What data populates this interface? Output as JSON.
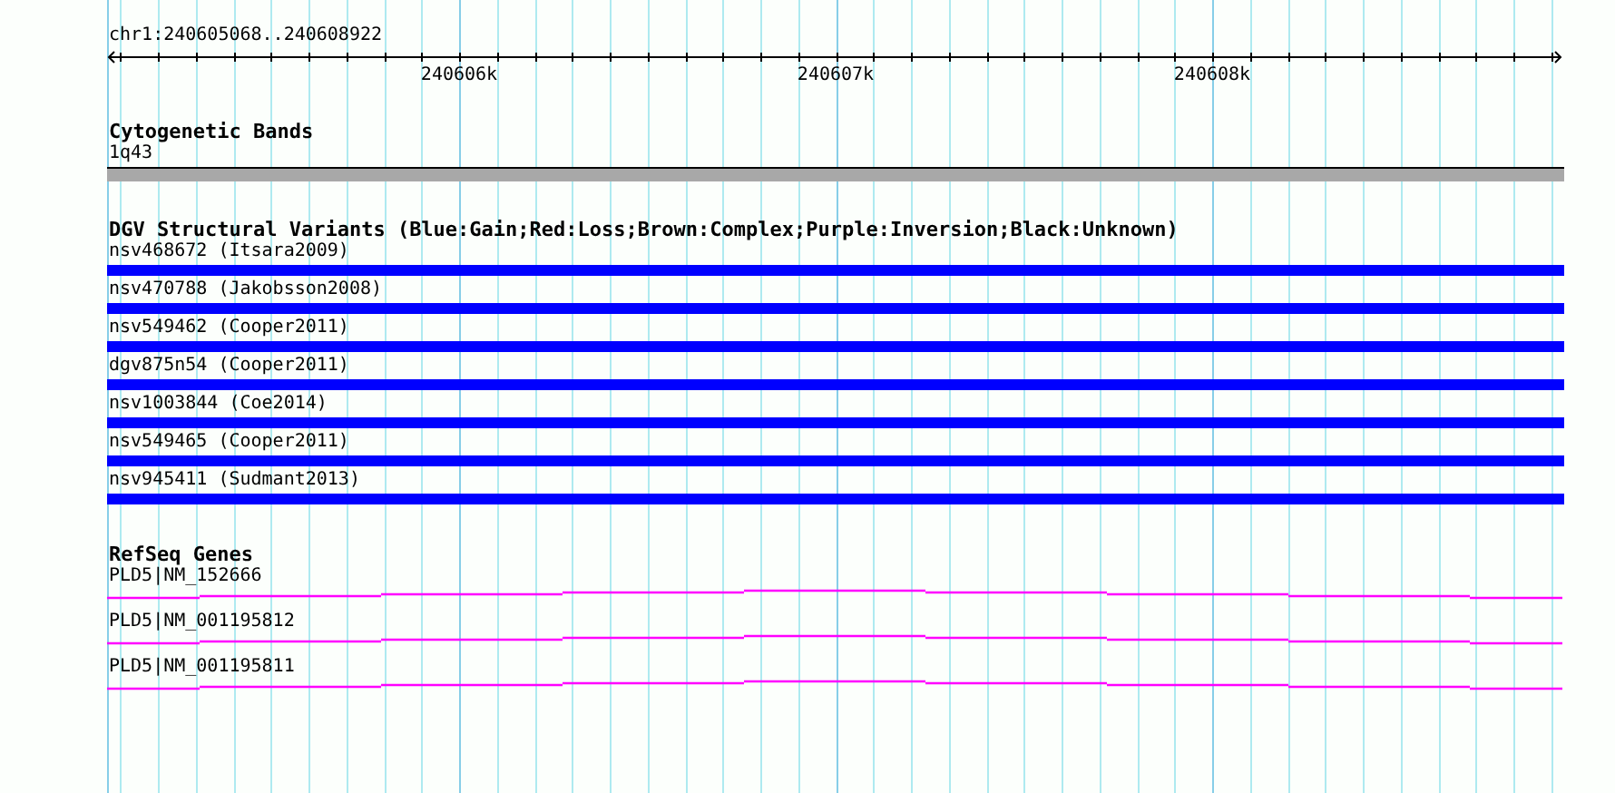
{
  "ruler": {
    "position": "chr1:240605068..240608922",
    "ticks": [
      "240606k",
      "240607k",
      "240608k"
    ]
  },
  "cytogenetic_bands": {
    "title": "Cytogenetic Bands",
    "band": "1q43"
  },
  "dgv_variants": {
    "title": "DGV Structural Variants (Blue:Gain;Red:Loss;Brown:Complex;Purple:Inversion;Black:Unknown)",
    "items": [
      {
        "label": "nsv468672 (Itsara2009)",
        "color": "#0000ff"
      },
      {
        "label": "nsv470788 (Jakobsson2008)",
        "color": "#0000ff"
      },
      {
        "label": "nsv549462 (Cooper2011)",
        "color": "#0000ff"
      },
      {
        "label": "dgv875n54 (Cooper2011)",
        "color": "#0000ff"
      },
      {
        "label": "nsv1003844 (Coe2014)",
        "color": "#0000ff"
      },
      {
        "label": "nsv549465 (Cooper2011)",
        "color": "#0000ff"
      },
      {
        "label": "nsv945411 (Sudmant2013)",
        "color": "#0000ff"
      }
    ]
  },
  "refseq_genes": {
    "title": "RefSeq Genes",
    "items": [
      {
        "label": "PLD5|NM_152666"
      },
      {
        "label": "PLD5|NM_001195812"
      },
      {
        "label": "PLD5|NM_001195811"
      }
    ]
  }
}
